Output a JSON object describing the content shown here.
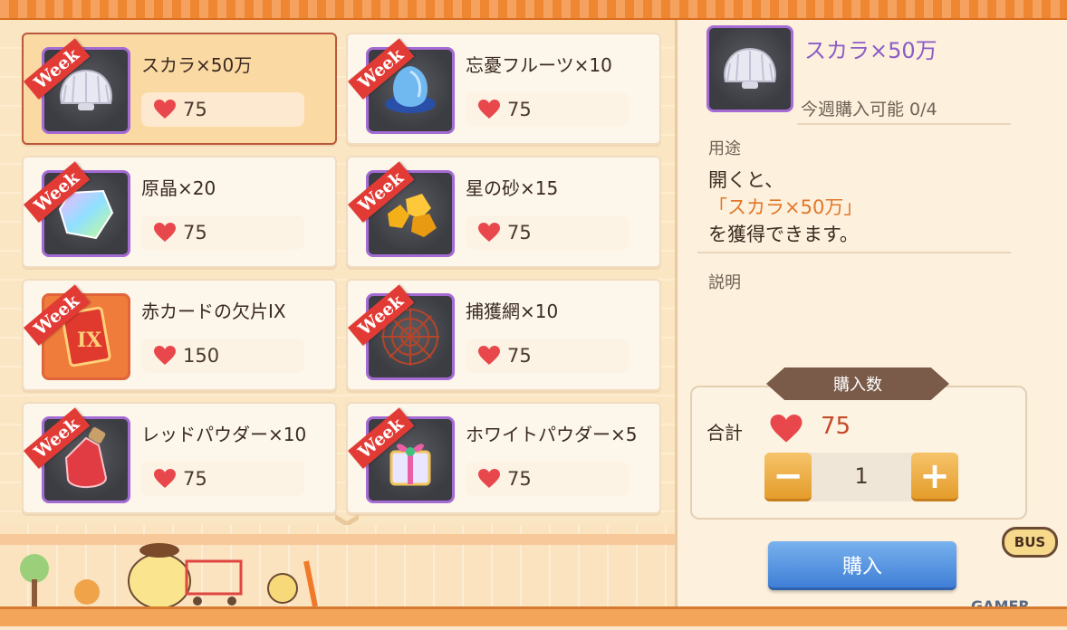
{
  "items": [
    {
      "ribbon": "Week",
      "name": "スカラ×50万",
      "price": "75",
      "icon": "scallop-shell-icon",
      "selected": true
    },
    {
      "ribbon": "Week",
      "name": "忘憂フルーツ×10",
      "price": "75",
      "icon": "blue-fruit-icon"
    },
    {
      "ribbon": "Week",
      "name": "原晶×20",
      "price": "75",
      "icon": "rainbow-crystal-icon"
    },
    {
      "ribbon": "Week",
      "name": "星の砂×15",
      "price": "75",
      "icon": "star-sand-icon"
    },
    {
      "ribbon": "Week",
      "name": "赤カードの欠片IX",
      "price": "150",
      "icon": "red-card-icon"
    },
    {
      "ribbon": "Week",
      "name": "捕獲網×10",
      "price": "75",
      "icon": "spider-net-icon"
    },
    {
      "ribbon": "Week",
      "name": "レッドパウダー×10",
      "price": "75",
      "icon": "red-potion-icon"
    },
    {
      "ribbon": "Week",
      "name": "ホワイトパウダー×5",
      "price": "75",
      "icon": "gift-box-icon"
    }
  ],
  "detail": {
    "title": "スカラ×50万",
    "limit": "今週購入可能 0/4",
    "usage_label": "用途",
    "usage_line1": "開くと、",
    "usage_line2": "「スカラ×50万」",
    "usage_line3": "を獲得できます。",
    "desc_label": "説明"
  },
  "purchase": {
    "header": "購入数",
    "total_label": "合計",
    "total_value": "75",
    "quantity": "1",
    "minus": "−",
    "plus": "+",
    "buy_label": "購入"
  },
  "decor": {
    "bus_sign": "BUS",
    "watermark": "GAMER"
  },
  "colors": {
    "ribbon": "#e23b35",
    "heart": "#e8484c",
    "buy_button": "#4f8ee0",
    "title_purple": "#8a5cc7"
  }
}
